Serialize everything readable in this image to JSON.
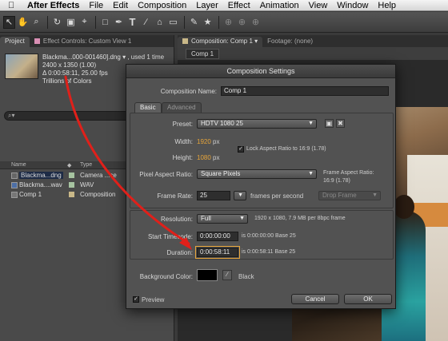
{
  "menubar": {
    "app": "After Effects",
    "items": [
      "File",
      "Edit",
      "Composition",
      "Layer",
      "Effect",
      "Animation",
      "View",
      "Window",
      "Help"
    ]
  },
  "project": {
    "tabs": [
      "Project",
      "Effect Controls: Custom View 1"
    ],
    "info": {
      "name": "Blackma...000-001460].dng ▾ , used 1 time",
      "size": "2400 x 1350 (1.00)",
      "duration": "Δ 0:00:58:11, 25.00 fps",
      "colors": "Trillions of Colors"
    },
    "search_placeholder": "⌕▾",
    "columns": [
      "Name",
      "Type"
    ],
    "items": [
      {
        "name": "Blackma...dng",
        "type": "Camera ...ce"
      },
      {
        "name": "Blackma....wav",
        "type": "WAV"
      },
      {
        "name": "Comp 1",
        "type": "Composition"
      }
    ]
  },
  "comp_panel": {
    "tabs": [
      "Composition: Comp 1",
      "Footage: (none)"
    ],
    "sub_tab": "Comp 1"
  },
  "dialog": {
    "title": "Composition Settings",
    "name_label": "Composition Name:",
    "name_value": "Comp 1",
    "tabs": [
      "Basic",
      "Advanced"
    ],
    "preset_label": "Preset:",
    "preset_value": "HDTV 1080 25",
    "width_label": "Width:",
    "width_value": "1920",
    "height_label": "Height:",
    "height_value": "1080",
    "px": "px",
    "lock_label": "Lock Aspect Ratio to 16:9 (1.78)",
    "par_label": "Pixel Aspect Ratio:",
    "par_value": "Square Pixels",
    "far_label": "Frame Aspect Ratio:",
    "far_value": "16:9 (1.78)",
    "fps_label": "Frame Rate:",
    "fps_value": "25",
    "fps_unit": "frames per second",
    "drop_frame": "Drop Frame",
    "res_label": "Resolution:",
    "res_value": "Full",
    "res_info": "1920 x 1080, 7.9 MB per 8bpc frame",
    "start_label": "Start Timecode:",
    "start_value": "0:00:00:00",
    "start_info": "is 0:00:00:00  Base 25",
    "dur_label": "Duration:",
    "dur_value": "0:00:58:11",
    "dur_info": "is 0:00:58:11  Base 25",
    "bg_label": "Background Color:",
    "bg_name": "Black",
    "bg_color": "#000000",
    "preview_label": "Preview",
    "cancel": "Cancel",
    "ok": "OK"
  },
  "annotation_color": "#e0201a"
}
